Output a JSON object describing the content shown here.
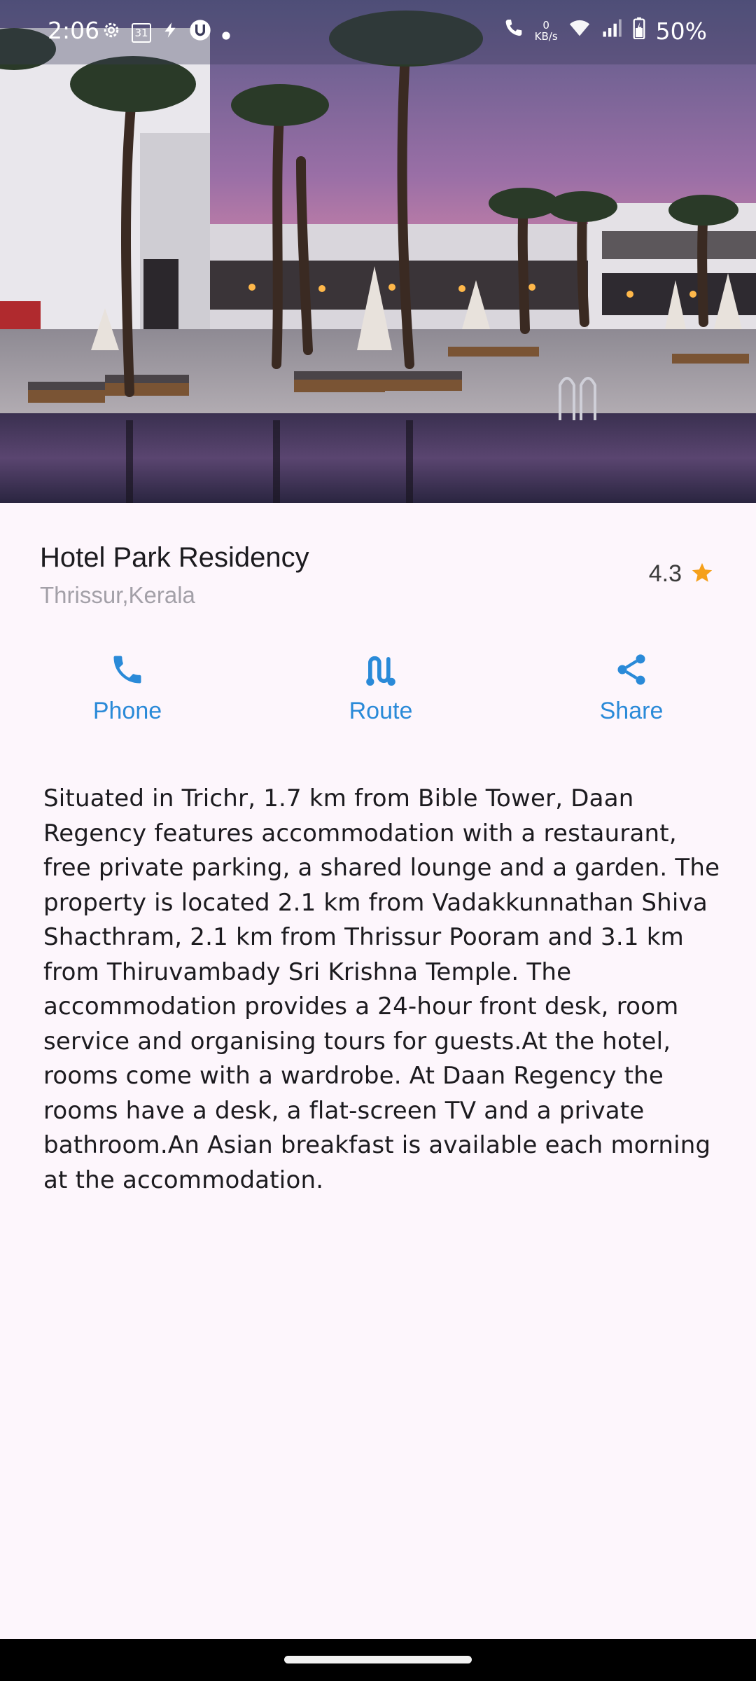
{
  "status_bar": {
    "time": "2:06",
    "left_icons": [
      "settings-icon",
      "calendar-icon",
      "bolt-icon",
      "app-icon",
      "dot-icon"
    ],
    "calendar_day": "31",
    "net_speed_value": "0",
    "net_speed_unit": "KB/s",
    "battery": "50%"
  },
  "hotel": {
    "name": "Hotel Park Residency",
    "location": "Thrissur,Kerala",
    "rating": "4.3",
    "rating_icon": "star-icon",
    "rating_color": "#f5a01a"
  },
  "actions": [
    {
      "label": "Phone",
      "icon": "phone-icon"
    },
    {
      "label": "Route",
      "icon": "route-icon"
    },
    {
      "label": "Share",
      "icon": "share-icon"
    }
  ],
  "accent_color": "#2a8ad8",
  "description": "Situated in Trichr, 1.7 km from Bible Tower, Daan Regency features accommodation with a restaurant, free private parking, a shared lounge and a garden. The property is located 2.1 km from Vadakkunnathan Shiva Shacthram, 2.1 km from Thrissur Pooram and 3.1 km from Thiruvambady Sri Krishna Temple. The accommodation provides a 24-hour front desk, room service and organising tours for guests.At the hotel, rooms come with a wardrobe. At Daan Regency the rooms have a desk, a flat-screen TV and a private bathroom.An Asian breakfast is available each morning at the accommodation."
}
